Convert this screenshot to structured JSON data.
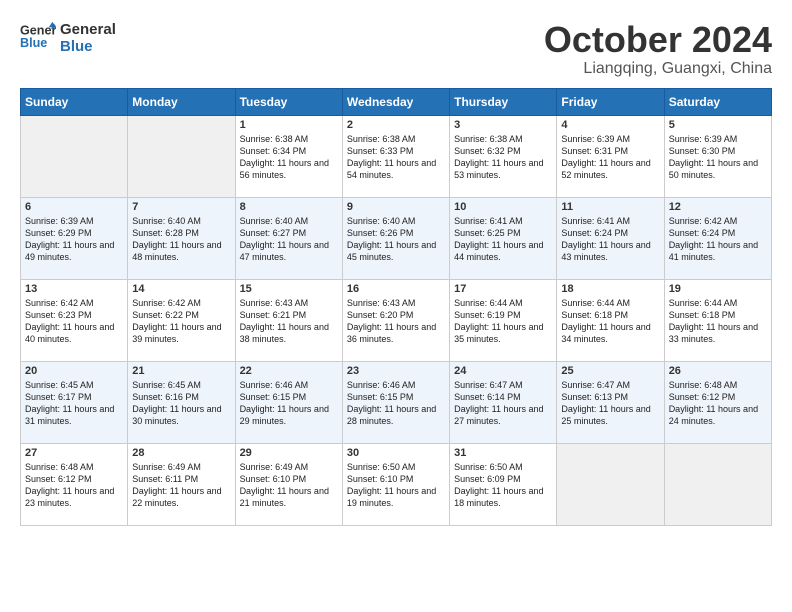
{
  "logo": {
    "line1": "General",
    "line2": "Blue"
  },
  "title": "October 2024",
  "subtitle": "Liangqing, Guangxi, China",
  "weekdays": [
    "Sunday",
    "Monday",
    "Tuesday",
    "Wednesday",
    "Thursday",
    "Friday",
    "Saturday"
  ],
  "weeks": [
    [
      {
        "day": "",
        "sunrise": "",
        "sunset": "",
        "daylight": ""
      },
      {
        "day": "",
        "sunrise": "",
        "sunset": "",
        "daylight": ""
      },
      {
        "day": "1",
        "sunrise": "Sunrise: 6:38 AM",
        "sunset": "Sunset: 6:34 PM",
        "daylight": "Daylight: 11 hours and 56 minutes."
      },
      {
        "day": "2",
        "sunrise": "Sunrise: 6:38 AM",
        "sunset": "Sunset: 6:33 PM",
        "daylight": "Daylight: 11 hours and 54 minutes."
      },
      {
        "day": "3",
        "sunrise": "Sunrise: 6:38 AM",
        "sunset": "Sunset: 6:32 PM",
        "daylight": "Daylight: 11 hours and 53 minutes."
      },
      {
        "day": "4",
        "sunrise": "Sunrise: 6:39 AM",
        "sunset": "Sunset: 6:31 PM",
        "daylight": "Daylight: 11 hours and 52 minutes."
      },
      {
        "day": "5",
        "sunrise": "Sunrise: 6:39 AM",
        "sunset": "Sunset: 6:30 PM",
        "daylight": "Daylight: 11 hours and 50 minutes."
      }
    ],
    [
      {
        "day": "6",
        "sunrise": "Sunrise: 6:39 AM",
        "sunset": "Sunset: 6:29 PM",
        "daylight": "Daylight: 11 hours and 49 minutes."
      },
      {
        "day": "7",
        "sunrise": "Sunrise: 6:40 AM",
        "sunset": "Sunset: 6:28 PM",
        "daylight": "Daylight: 11 hours and 48 minutes."
      },
      {
        "day": "8",
        "sunrise": "Sunrise: 6:40 AM",
        "sunset": "Sunset: 6:27 PM",
        "daylight": "Daylight: 11 hours and 47 minutes."
      },
      {
        "day": "9",
        "sunrise": "Sunrise: 6:40 AM",
        "sunset": "Sunset: 6:26 PM",
        "daylight": "Daylight: 11 hours and 45 minutes."
      },
      {
        "day": "10",
        "sunrise": "Sunrise: 6:41 AM",
        "sunset": "Sunset: 6:25 PM",
        "daylight": "Daylight: 11 hours and 44 minutes."
      },
      {
        "day": "11",
        "sunrise": "Sunrise: 6:41 AM",
        "sunset": "Sunset: 6:24 PM",
        "daylight": "Daylight: 11 hours and 43 minutes."
      },
      {
        "day": "12",
        "sunrise": "Sunrise: 6:42 AM",
        "sunset": "Sunset: 6:24 PM",
        "daylight": "Daylight: 11 hours and 41 minutes."
      }
    ],
    [
      {
        "day": "13",
        "sunrise": "Sunrise: 6:42 AM",
        "sunset": "Sunset: 6:23 PM",
        "daylight": "Daylight: 11 hours and 40 minutes."
      },
      {
        "day": "14",
        "sunrise": "Sunrise: 6:42 AM",
        "sunset": "Sunset: 6:22 PM",
        "daylight": "Daylight: 11 hours and 39 minutes."
      },
      {
        "day": "15",
        "sunrise": "Sunrise: 6:43 AM",
        "sunset": "Sunset: 6:21 PM",
        "daylight": "Daylight: 11 hours and 38 minutes."
      },
      {
        "day": "16",
        "sunrise": "Sunrise: 6:43 AM",
        "sunset": "Sunset: 6:20 PM",
        "daylight": "Daylight: 11 hours and 36 minutes."
      },
      {
        "day": "17",
        "sunrise": "Sunrise: 6:44 AM",
        "sunset": "Sunset: 6:19 PM",
        "daylight": "Daylight: 11 hours and 35 minutes."
      },
      {
        "day": "18",
        "sunrise": "Sunrise: 6:44 AM",
        "sunset": "Sunset: 6:18 PM",
        "daylight": "Daylight: 11 hours and 34 minutes."
      },
      {
        "day": "19",
        "sunrise": "Sunrise: 6:44 AM",
        "sunset": "Sunset: 6:18 PM",
        "daylight": "Daylight: 11 hours and 33 minutes."
      }
    ],
    [
      {
        "day": "20",
        "sunrise": "Sunrise: 6:45 AM",
        "sunset": "Sunset: 6:17 PM",
        "daylight": "Daylight: 11 hours and 31 minutes."
      },
      {
        "day": "21",
        "sunrise": "Sunrise: 6:45 AM",
        "sunset": "Sunset: 6:16 PM",
        "daylight": "Daylight: 11 hours and 30 minutes."
      },
      {
        "day": "22",
        "sunrise": "Sunrise: 6:46 AM",
        "sunset": "Sunset: 6:15 PM",
        "daylight": "Daylight: 11 hours and 29 minutes."
      },
      {
        "day": "23",
        "sunrise": "Sunrise: 6:46 AM",
        "sunset": "Sunset: 6:15 PM",
        "daylight": "Daylight: 11 hours and 28 minutes."
      },
      {
        "day": "24",
        "sunrise": "Sunrise: 6:47 AM",
        "sunset": "Sunset: 6:14 PM",
        "daylight": "Daylight: 11 hours and 27 minutes."
      },
      {
        "day": "25",
        "sunrise": "Sunrise: 6:47 AM",
        "sunset": "Sunset: 6:13 PM",
        "daylight": "Daylight: 11 hours and 25 minutes."
      },
      {
        "day": "26",
        "sunrise": "Sunrise: 6:48 AM",
        "sunset": "Sunset: 6:12 PM",
        "daylight": "Daylight: 11 hours and 24 minutes."
      }
    ],
    [
      {
        "day": "27",
        "sunrise": "Sunrise: 6:48 AM",
        "sunset": "Sunset: 6:12 PM",
        "daylight": "Daylight: 11 hours and 23 minutes."
      },
      {
        "day": "28",
        "sunrise": "Sunrise: 6:49 AM",
        "sunset": "Sunset: 6:11 PM",
        "daylight": "Daylight: 11 hours and 22 minutes."
      },
      {
        "day": "29",
        "sunrise": "Sunrise: 6:49 AM",
        "sunset": "Sunset: 6:10 PM",
        "daylight": "Daylight: 11 hours and 21 minutes."
      },
      {
        "day": "30",
        "sunrise": "Sunrise: 6:50 AM",
        "sunset": "Sunset: 6:10 PM",
        "daylight": "Daylight: 11 hours and 19 minutes."
      },
      {
        "day": "31",
        "sunrise": "Sunrise: 6:50 AM",
        "sunset": "Sunset: 6:09 PM",
        "daylight": "Daylight: 11 hours and 18 minutes."
      },
      {
        "day": "",
        "sunrise": "",
        "sunset": "",
        "daylight": ""
      },
      {
        "day": "",
        "sunrise": "",
        "sunset": "",
        "daylight": ""
      }
    ]
  ]
}
